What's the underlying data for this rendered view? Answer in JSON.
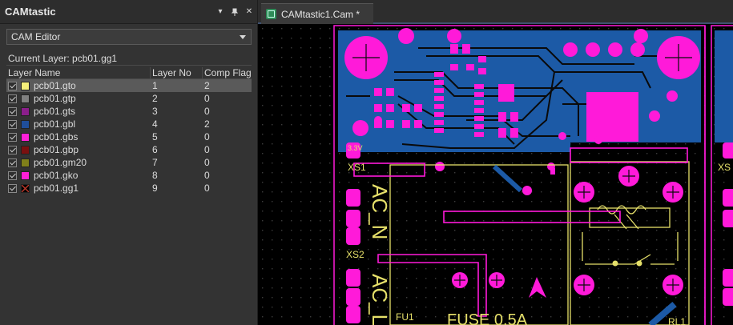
{
  "panel": {
    "title": "CAMtastic",
    "pin_icon": "▾",
    "float_icon": "⊞",
    "close_icon": "✕",
    "dropdown_value": "CAM Editor",
    "current_layer": "Current Layer: pcb01.gg1",
    "columns": [
      "Layer Name",
      "Layer No",
      "Comp Flag"
    ],
    "layers": [
      {
        "name": "pcb01.gto",
        "no": "1",
        "flag": "2",
        "color": "#f5f07a",
        "selected": true
      },
      {
        "name": "pcb01.gtp",
        "no": "2",
        "flag": "0",
        "color": "#808080"
      },
      {
        "name": "pcb01.gts",
        "no": "3",
        "flag": "0",
        "color": "#8b1e8b"
      },
      {
        "name": "pcb01.gbl",
        "no": "4",
        "flag": "2",
        "color": "#1f4e9a"
      },
      {
        "name": "pcb01.gbs",
        "no": "5",
        "flag": "0",
        "color": "#ff1fd8"
      },
      {
        "name": "pcb01.gbp",
        "no": "6",
        "flag": "0",
        "color": "#7a1010"
      },
      {
        "name": "pcb01.gm20",
        "no": "7",
        "flag": "0",
        "color": "#7f7f1a"
      },
      {
        "name": "pcb01.gko",
        "no": "8",
        "flag": "0",
        "color": "#ff1fd8"
      },
      {
        "name": "pcb01.gg1",
        "no": "9",
        "flag": "0",
        "color": "#000000"
      }
    ]
  },
  "tab": {
    "label": "CAMtastic1.Cam *"
  },
  "board_labels": {
    "xs1": "XS1",
    "xs2": "XS2",
    "v33": "3.3V",
    "ac_n": "AC_N",
    "ac_l": "AC_L",
    "fu1": "FU1",
    "fuse": "FUSE 0.5A",
    "rl1": "RL1",
    "xs_right": "XS"
  },
  "colors": {
    "copper_bottom": "#1c5aa6",
    "pad": "#ff1ad9",
    "silk": "#e6e06a",
    "paste": "#9e1b2f",
    "canvas": "#000000"
  }
}
